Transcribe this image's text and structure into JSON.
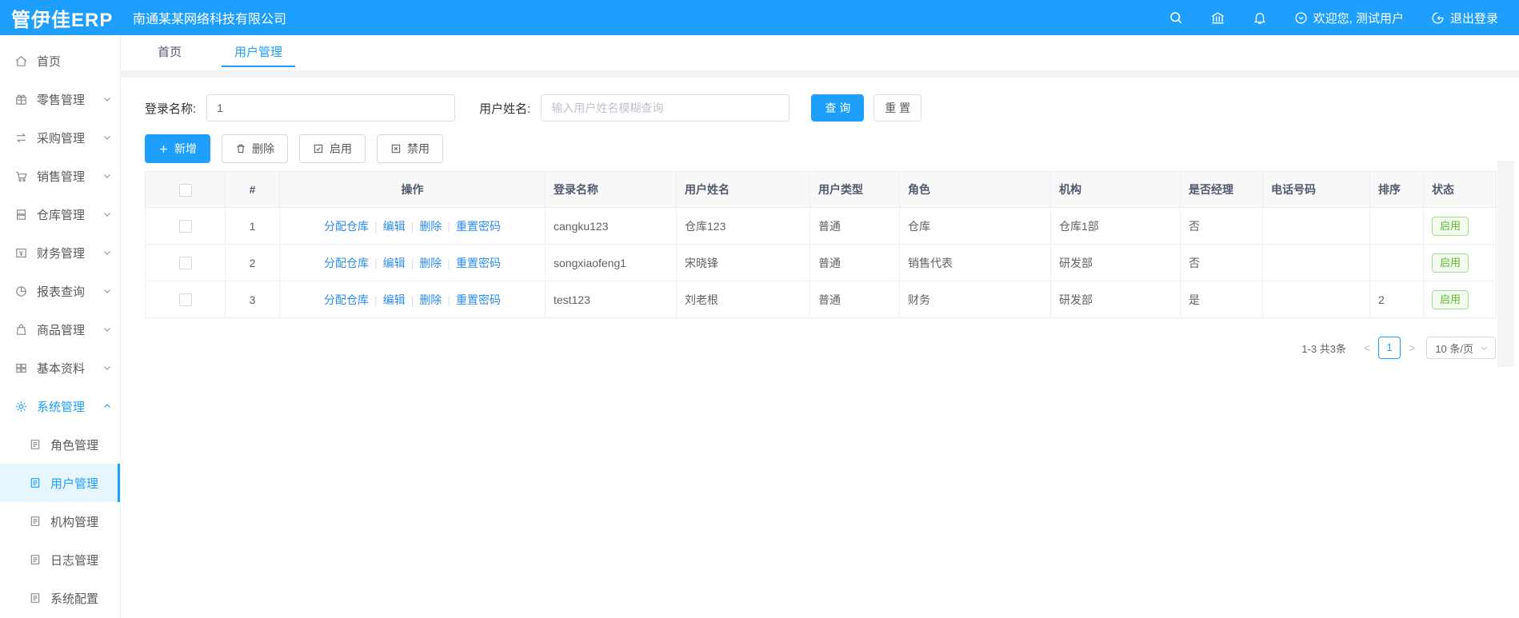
{
  "colors": {
    "primary": "#1E9FFF",
    "link": "#2d8cf0",
    "status_enabled": "#5fb832"
  },
  "header": {
    "logo": "管伊佳ERP",
    "company": "南通某某网络科技有限公司",
    "welcome": "欢迎您, 测试用户",
    "logout": "退出登录"
  },
  "tabs": [
    {
      "label": "首页"
    },
    {
      "label": "用户管理"
    }
  ],
  "sidebar": {
    "items": [
      {
        "label": "首页"
      },
      {
        "label": "零售管理"
      },
      {
        "label": "采购管理"
      },
      {
        "label": "销售管理"
      },
      {
        "label": "仓库管理"
      },
      {
        "label": "财务管理"
      },
      {
        "label": "报表查询"
      },
      {
        "label": "商品管理"
      },
      {
        "label": "基本资料"
      },
      {
        "label": "系统管理"
      }
    ],
    "system_children": [
      {
        "label": "角色管理"
      },
      {
        "label": "用户管理"
      },
      {
        "label": "机构管理"
      },
      {
        "label": "日志管理"
      },
      {
        "label": "系统配置"
      }
    ]
  },
  "filters": {
    "login_label": "登录名称:",
    "login_value": "1",
    "name_label": "用户姓名:",
    "name_placeholder": "输入用户姓名模糊查询",
    "search_label": "查 询",
    "reset_label": "重 置"
  },
  "toolbar": {
    "add_label": "新增",
    "delete_label": "删除",
    "enable_label": "启用",
    "disable_label": "禁用"
  },
  "table": {
    "headers": [
      "",
      "#",
      "操作",
      "登录名称",
      "用户姓名",
      "用户类型",
      "角色",
      "机构",
      "是否经理",
      "电话号码",
      "排序",
      "状态"
    ],
    "ops": [
      "分配仓库",
      "编辑",
      "删除",
      "重置密码"
    ],
    "rows": [
      {
        "index": "1",
        "login": "cangku123",
        "name": "仓库123",
        "type": "普通",
        "role": "仓库",
        "org": "仓库1部",
        "manager": "否",
        "phone": "",
        "sort": "",
        "status": "启用"
      },
      {
        "index": "2",
        "login": "songxiaofeng1",
        "name": "宋晓锋",
        "type": "普通",
        "role": "销售代表",
        "org": "研发部",
        "manager": "否",
        "phone": "",
        "sort": "",
        "status": "启用"
      },
      {
        "index": "3",
        "login": "test123",
        "name": "刘老根",
        "type": "普通",
        "role": "财务",
        "org": "研发部",
        "manager": "是",
        "phone": "",
        "sort": "2",
        "status": "启用"
      }
    ]
  },
  "pagination": {
    "total": "1-3 共3条",
    "prev": "<",
    "page": "1",
    "next": ">",
    "page_size": "10 条/页"
  }
}
